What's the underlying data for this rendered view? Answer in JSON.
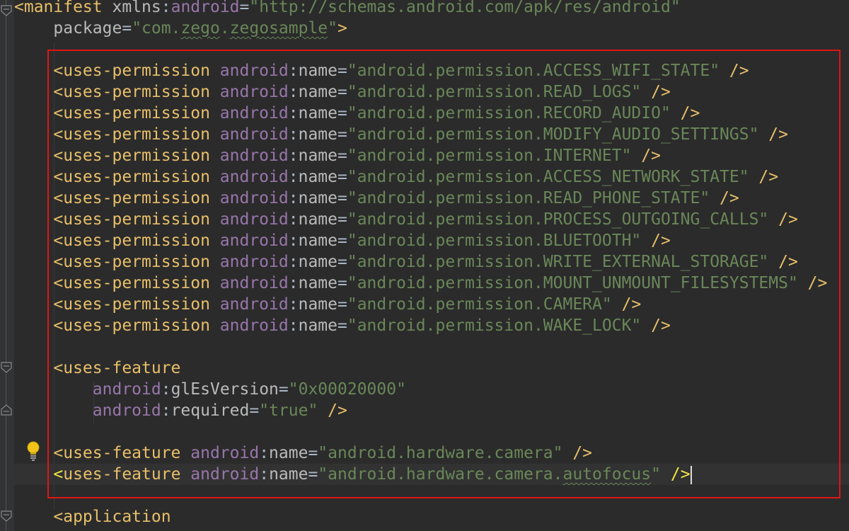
{
  "lines": [
    {
      "id": "manifest-open",
      "segments": [
        {
          "c": "tag",
          "t": "<manifest "
        },
        {
          "c": "attr",
          "t": "xmlns"
        },
        {
          "c": "punct",
          "t": ":"
        },
        {
          "c": "ns",
          "t": "android"
        },
        {
          "c": "punct",
          "t": "="
        },
        {
          "c": "val",
          "t": "\"http://schemas.android.com/apk/res/android\""
        }
      ]
    },
    {
      "id": "manifest-package",
      "segments": [
        {
          "c": "punct",
          "t": "    "
        },
        {
          "c": "attr",
          "t": "package"
        },
        {
          "c": "punct",
          "t": "="
        },
        {
          "c": "val",
          "t": "\"com."
        },
        {
          "c": "val uline",
          "t": "zego"
        },
        {
          "c": "val",
          "t": "."
        },
        {
          "c": "val uline",
          "t": "zegosample"
        },
        {
          "c": "val",
          "t": "\""
        },
        {
          "c": "tag",
          "t": ">"
        }
      ]
    },
    {
      "id": "blank-1",
      "segments": []
    },
    {
      "id": "perm-access-wifi-state",
      "segments": [
        {
          "c": "tag",
          "t": "    <uses-permission "
        },
        {
          "c": "ns",
          "t": "android"
        },
        {
          "c": "punct",
          "t": ":"
        },
        {
          "c": "attr",
          "t": "name"
        },
        {
          "c": "punct",
          "t": "="
        },
        {
          "c": "val",
          "t": "\"android.permission.ACCESS_WIFI_STATE\""
        },
        {
          "c": "tag",
          "t": " />"
        }
      ]
    },
    {
      "id": "perm-read-logs",
      "segments": [
        {
          "c": "tag",
          "t": "    <uses-permission "
        },
        {
          "c": "ns",
          "t": "android"
        },
        {
          "c": "punct",
          "t": ":"
        },
        {
          "c": "attr",
          "t": "name"
        },
        {
          "c": "punct",
          "t": "="
        },
        {
          "c": "val",
          "t": "\"android.permission.READ_LOGS\""
        },
        {
          "c": "tag",
          "t": " />"
        }
      ]
    },
    {
      "id": "perm-record-audio",
      "segments": [
        {
          "c": "tag",
          "t": "    <uses-permission "
        },
        {
          "c": "ns",
          "t": "android"
        },
        {
          "c": "punct",
          "t": ":"
        },
        {
          "c": "attr",
          "t": "name"
        },
        {
          "c": "punct",
          "t": "="
        },
        {
          "c": "val",
          "t": "\"android.permission.RECORD_AUDIO\""
        },
        {
          "c": "tag",
          "t": " />"
        }
      ]
    },
    {
      "id": "perm-modify-audio-settings",
      "segments": [
        {
          "c": "tag",
          "t": "    <uses-permission "
        },
        {
          "c": "ns",
          "t": "android"
        },
        {
          "c": "punct",
          "t": ":"
        },
        {
          "c": "attr",
          "t": "name"
        },
        {
          "c": "punct",
          "t": "="
        },
        {
          "c": "val",
          "t": "\"android.permission.MODIFY_AUDIO_SETTINGS\""
        },
        {
          "c": "tag",
          "t": " />"
        }
      ]
    },
    {
      "id": "perm-internet",
      "segments": [
        {
          "c": "tag",
          "t": "    <uses-permission "
        },
        {
          "c": "ns",
          "t": "android"
        },
        {
          "c": "punct",
          "t": ":"
        },
        {
          "c": "attr",
          "t": "name"
        },
        {
          "c": "punct",
          "t": "="
        },
        {
          "c": "val",
          "t": "\"android.permission.INTERNET\""
        },
        {
          "c": "tag",
          "t": " />"
        }
      ]
    },
    {
      "id": "perm-access-network-state",
      "segments": [
        {
          "c": "tag",
          "t": "    <uses-permission "
        },
        {
          "c": "ns",
          "t": "android"
        },
        {
          "c": "punct",
          "t": ":"
        },
        {
          "c": "attr",
          "t": "name"
        },
        {
          "c": "punct",
          "t": "="
        },
        {
          "c": "val",
          "t": "\"android.permission.ACCESS_NETWORK_STATE\""
        },
        {
          "c": "tag",
          "t": " />"
        }
      ]
    },
    {
      "id": "perm-read-phone-state",
      "segments": [
        {
          "c": "tag",
          "t": "    <uses-permission "
        },
        {
          "c": "ns",
          "t": "android"
        },
        {
          "c": "punct",
          "t": ":"
        },
        {
          "c": "attr",
          "t": "name"
        },
        {
          "c": "punct",
          "t": "="
        },
        {
          "c": "val",
          "t": "\"android.permission.READ_PHONE_STATE\""
        },
        {
          "c": "tag",
          "t": " />"
        }
      ]
    },
    {
      "id": "perm-process-outgoing-calls",
      "segments": [
        {
          "c": "tag",
          "t": "    <uses-permission "
        },
        {
          "c": "ns",
          "t": "android"
        },
        {
          "c": "punct",
          "t": ":"
        },
        {
          "c": "attr",
          "t": "name"
        },
        {
          "c": "punct",
          "t": "="
        },
        {
          "c": "val",
          "t": "\"android.permission.PROCESS_OUTGOING_CALLS\""
        },
        {
          "c": "tag",
          "t": " />"
        }
      ]
    },
    {
      "id": "perm-bluetooth",
      "segments": [
        {
          "c": "tag",
          "t": "    <uses-permission "
        },
        {
          "c": "ns",
          "t": "android"
        },
        {
          "c": "punct",
          "t": ":"
        },
        {
          "c": "attr",
          "t": "name"
        },
        {
          "c": "punct",
          "t": "="
        },
        {
          "c": "val",
          "t": "\"android.permission.BLUETOOTH\""
        },
        {
          "c": "tag",
          "t": " />"
        }
      ]
    },
    {
      "id": "perm-write-external-storage",
      "segments": [
        {
          "c": "tag",
          "t": "    <uses-permission "
        },
        {
          "c": "ns",
          "t": "android"
        },
        {
          "c": "punct",
          "t": ":"
        },
        {
          "c": "attr",
          "t": "name"
        },
        {
          "c": "punct",
          "t": "="
        },
        {
          "c": "val",
          "t": "\"android.permission.WRITE_EXTERNAL_STORAGE\""
        },
        {
          "c": "tag",
          "t": " />"
        }
      ]
    },
    {
      "id": "perm-mount-unmount-filesystems",
      "segments": [
        {
          "c": "tag",
          "t": "    <uses-permission "
        },
        {
          "c": "ns",
          "t": "android"
        },
        {
          "c": "punct",
          "t": ":"
        },
        {
          "c": "attr",
          "t": "name"
        },
        {
          "c": "punct",
          "t": "="
        },
        {
          "c": "val",
          "t": "\"android.permission.MOUNT_UNMOUNT_FILESYSTEMS\""
        },
        {
          "c": "tag",
          "t": " />"
        }
      ]
    },
    {
      "id": "perm-camera",
      "segments": [
        {
          "c": "tag",
          "t": "    <uses-permission "
        },
        {
          "c": "ns",
          "t": "android"
        },
        {
          "c": "punct",
          "t": ":"
        },
        {
          "c": "attr",
          "t": "name"
        },
        {
          "c": "punct",
          "t": "="
        },
        {
          "c": "val",
          "t": "\"android.permission.CAMERA\""
        },
        {
          "c": "tag",
          "t": " />"
        }
      ]
    },
    {
      "id": "perm-wake-lock",
      "segments": [
        {
          "c": "tag",
          "t": "    <uses-permission "
        },
        {
          "c": "ns",
          "t": "android"
        },
        {
          "c": "punct",
          "t": ":"
        },
        {
          "c": "attr",
          "t": "name"
        },
        {
          "c": "punct",
          "t": "="
        },
        {
          "c": "val",
          "t": "\"android.permission.WAKE_LOCK\""
        },
        {
          "c": "tag",
          "t": " />"
        }
      ]
    },
    {
      "id": "blank-2",
      "segments": []
    },
    {
      "id": "feature-open",
      "segments": [
        {
          "c": "tag",
          "t": "    <uses-feature"
        }
      ]
    },
    {
      "id": "feature-gles",
      "segments": [
        {
          "c": "punct",
          "t": "        "
        },
        {
          "c": "ns",
          "t": "android"
        },
        {
          "c": "punct",
          "t": ":"
        },
        {
          "c": "attr",
          "t": "glEsVersion"
        },
        {
          "c": "punct",
          "t": "="
        },
        {
          "c": "val",
          "t": "\"0x00020000\""
        }
      ]
    },
    {
      "id": "feature-required",
      "segments": [
        {
          "c": "punct",
          "t": "        "
        },
        {
          "c": "ns",
          "t": "android"
        },
        {
          "c": "punct",
          "t": ":"
        },
        {
          "c": "attr",
          "t": "required"
        },
        {
          "c": "punct",
          "t": "="
        },
        {
          "c": "val",
          "t": "\"true\""
        },
        {
          "c": "tag",
          "t": " />"
        }
      ]
    },
    {
      "id": "blank-3",
      "segments": []
    },
    {
      "id": "feature-camera",
      "segments": [
        {
          "c": "tag",
          "t": "    <uses-feature "
        },
        {
          "c": "ns",
          "t": "android"
        },
        {
          "c": "punct",
          "t": ":"
        },
        {
          "c": "attr",
          "t": "name"
        },
        {
          "c": "punct",
          "t": "="
        },
        {
          "c": "val",
          "t": "\"android.hardware.camera\""
        },
        {
          "c": "tag",
          "t": " />"
        }
      ]
    },
    {
      "id": "feature-camera-autofocus",
      "current": true,
      "segments": [
        {
          "c": "punct",
          "t": "    "
        },
        {
          "c": "tag-bright",
          "t": "<"
        },
        {
          "c": "tag",
          "t": "uses-feature "
        },
        {
          "c": "ns",
          "t": "android"
        },
        {
          "c": "punct",
          "t": ":"
        },
        {
          "c": "attr",
          "t": "name"
        },
        {
          "c": "punct",
          "t": "="
        },
        {
          "c": "val",
          "t": "\"android.hardware.camera."
        },
        {
          "c": "val uline",
          "t": "autofocus"
        },
        {
          "c": "val",
          "t": "\""
        },
        {
          "c": "tag",
          "t": " "
        },
        {
          "c": "tag-bright",
          "t": "/>"
        },
        {
          "c": "caret",
          "t": ""
        }
      ]
    },
    {
      "id": "blank-4",
      "segments": []
    },
    {
      "id": "application-open",
      "segments": [
        {
          "c": "tag",
          "t": "    <application"
        }
      ]
    }
  ],
  "colors": {
    "background": "#2b2b2b",
    "tag": "#e8bf6a",
    "namespace": "#9876aa",
    "attribute": "#bababa",
    "string": "#6a8759",
    "highlight_box": "#e01515"
  },
  "icons": {
    "gutter": [
      "fold-marker-icon",
      "lightbulb-icon"
    ]
  }
}
